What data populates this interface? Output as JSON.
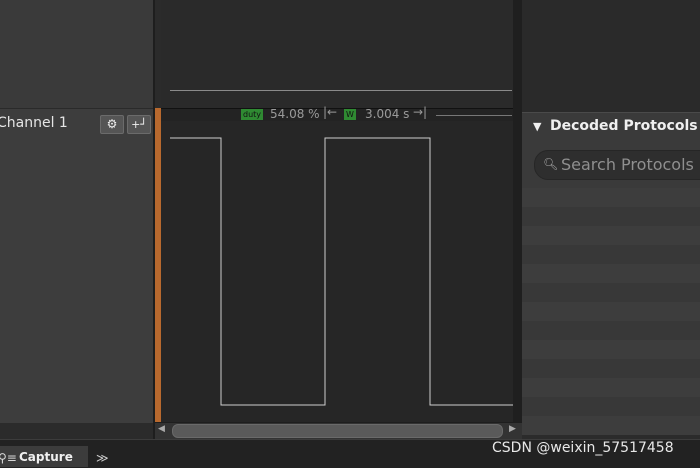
{
  "channel": {
    "label": "Channel 1"
  },
  "measurements": {
    "duty_tag": "duty",
    "duty_value": "54.08 %",
    "width_tag": "W",
    "width_value": "3.004 s"
  },
  "panel": {
    "title": "Decoded Protocols",
    "search_placeholder": "Search Protocols"
  },
  "tabs": {
    "capture": "Capture"
  },
  "watermark": "CSDN @weixin_57517458",
  "colors": {
    "channel_accent": "#b8692e",
    "tag_green": "#2f8a32"
  },
  "icons": {
    "settings": "gear-icon",
    "trigger": "trigger-icon",
    "collapse": "triangle-down-icon",
    "search": "search-icon",
    "more": "double-chevron-icon"
  }
}
